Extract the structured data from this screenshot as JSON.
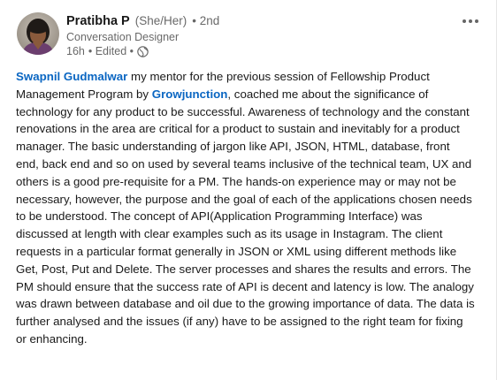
{
  "post": {
    "author": {
      "name": "Pratibha P",
      "pronouns": "(She/Her)",
      "degree": "• 2nd",
      "headline": "Conversation Designer",
      "time": "16h",
      "edited": "• Edited •",
      "visibility_icon": "globe-icon"
    },
    "menu_icon": "more-options-icon",
    "body": {
      "mention_1": "Swapnil Gudmalwar",
      "text_1": " my mentor for the previous session of Fellowship Product Management Program by ",
      "mention_2": "Growjunction",
      "text_2": ", coached me about the significance of technology for any product to be successful. Awareness of technology and the constant renovations in the area are critical for a product to sustain and inevitably for a product manager. The basic understanding of jargon like API, JSON, HTML, database, front end, back end and so on used by several teams inclusive of the technical team, UX and others is a good pre-requisite for a PM. The hands-on experience may or may not be necessary, however, the purpose and the goal of each of the applications chosen needs to be understood. The concept of API(Application Programming Interface) was discussed at length with clear examples such as its usage in Instagram. The client requests in a particular format generally in JSON or XML using different methods like Get, Post, Put and Delete. The server processes and shares the results and errors. The PM should ensure that the success rate of API is decent and latency is low. The analogy was drawn between database and oil due to the growing importance of data. The data is further analysed and the issues (if any) have to be assigned to the right team for fixing or enhancing."
    }
  },
  "colors": {
    "link": "#0a66c2",
    "text": "#191919",
    "muted": "#666666"
  }
}
